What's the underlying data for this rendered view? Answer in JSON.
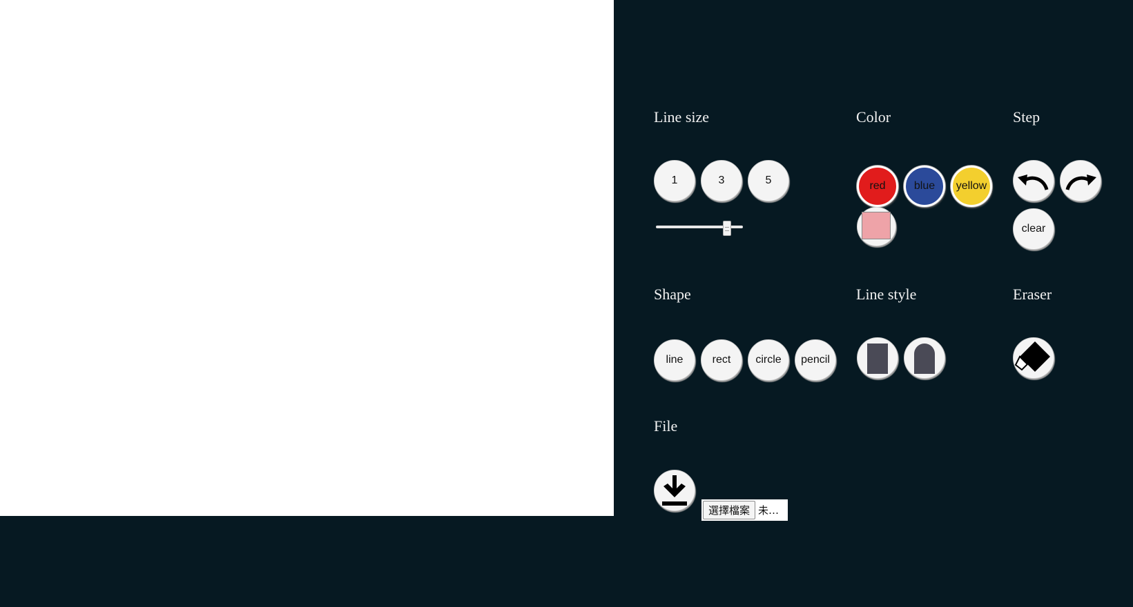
{
  "sections": {
    "line_size": "Line size",
    "color": "Color",
    "step": "Step",
    "shape": "Shape",
    "line_style": "Line style",
    "eraser": "Eraser",
    "file": "File"
  },
  "line_size": {
    "buttons": [
      "1",
      "3",
      "5"
    ],
    "slider_value_fraction": 0.85
  },
  "colors": {
    "buttons": [
      {
        "label": "red",
        "color": "#e11c1c"
      },
      {
        "label": "blue",
        "color": "#2b4a9a"
      },
      {
        "label": "yellow",
        "color": "#f3cf2e"
      }
    ],
    "current_swatch": "#eea3a8"
  },
  "step": {
    "undo_icon": "undo-icon",
    "redo_icon": "redo-icon",
    "clear": "clear"
  },
  "shape": {
    "buttons": [
      "line",
      "rect",
      "circle",
      "pencil"
    ]
  },
  "line_style": {
    "icons": [
      "square-cap-icon",
      "round-cap-icon"
    ]
  },
  "eraser": {
    "icon": "eraser-icon"
  },
  "file": {
    "download_icon": "download-icon",
    "choose_label": "選擇檔案",
    "status": "未…"
  }
}
